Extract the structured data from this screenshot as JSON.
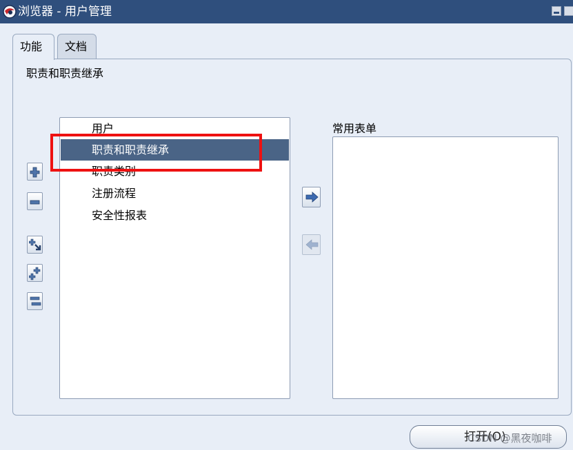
{
  "window": {
    "title": "浏览器 - 用户管理"
  },
  "tabs": [
    {
      "label": "功能",
      "active": true
    },
    {
      "label": "文档",
      "active": false
    }
  ],
  "section_title": "职责和职责继承",
  "left_list": {
    "items": [
      {
        "label": "用户",
        "selected": false
      },
      {
        "label": "职责和职责继承",
        "selected": true
      },
      {
        "label": "职责类别",
        "selected": false
      },
      {
        "label": "注册流程",
        "selected": false
      },
      {
        "label": "安全性报表",
        "selected": false
      }
    ]
  },
  "right_list": {
    "label": "常用表单",
    "items": []
  },
  "buttons": {
    "open_label": "打开(O)"
  },
  "watermark": "CSDN @黑夜咖啡",
  "icons": {
    "app": "globe-icon",
    "expand": "plus-icon",
    "collapse": "minus-icon",
    "expand_all": "expand-all-icon",
    "expand_branch": "expand-branch-icon",
    "collapse_all": "collapse-all-icon",
    "add": "arrow-right-icon",
    "remove": "arrow-left-icon"
  },
  "colors": {
    "title_bar": "#2f4f7d",
    "selection": "#4a6486",
    "highlight_box": "#ee1111",
    "background": "#e8eef7"
  }
}
